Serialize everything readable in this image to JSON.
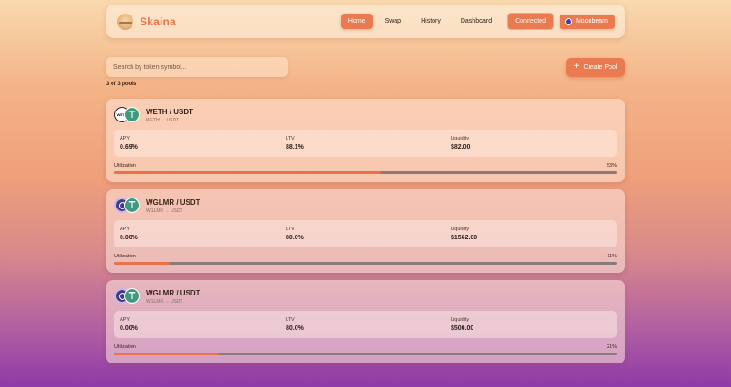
{
  "brand": {
    "name": "Skaina"
  },
  "nav": {
    "items": [
      "Home",
      "Swap",
      "History",
      "Dashboard"
    ],
    "connected_label": "Connected",
    "network_label": "Moonbeam"
  },
  "search": {
    "placeholder": "Search by token symbol..."
  },
  "create_button": {
    "label": "Create Pool"
  },
  "pool_count": "3 of 3 pools",
  "stat_labels": {
    "apy": "APY",
    "ltv": "LTV",
    "liquidity": "Liquidity",
    "utilization": "Utilization"
  },
  "pools": [
    {
      "name": "WETH / USDT",
      "route": "WETH → USDT",
      "token_a": "WETH",
      "token_b_glyph": "T",
      "apy": "0.69%",
      "ltv": "88.1%",
      "liquidity": "$82.00",
      "utilization": "53%",
      "utilization_value": 0.53
    },
    {
      "name": "WGLMR / USDT",
      "route": "WGLMR → USDT",
      "token_a": "",
      "token_b_glyph": "T",
      "apy": "0.00%",
      "ltv": "80.0%",
      "liquidity": "$1562.00",
      "utilization": "11%",
      "utilization_value": 0.11
    },
    {
      "name": "WGLMR / USDT",
      "route": "WGLMR → USDT",
      "token_a": "",
      "token_b_glyph": "T",
      "apy": "0.00%",
      "ltv": "80.0%",
      "liquidity": "$500.00",
      "utilization": "21%",
      "utilization_value": 0.21
    }
  ]
}
